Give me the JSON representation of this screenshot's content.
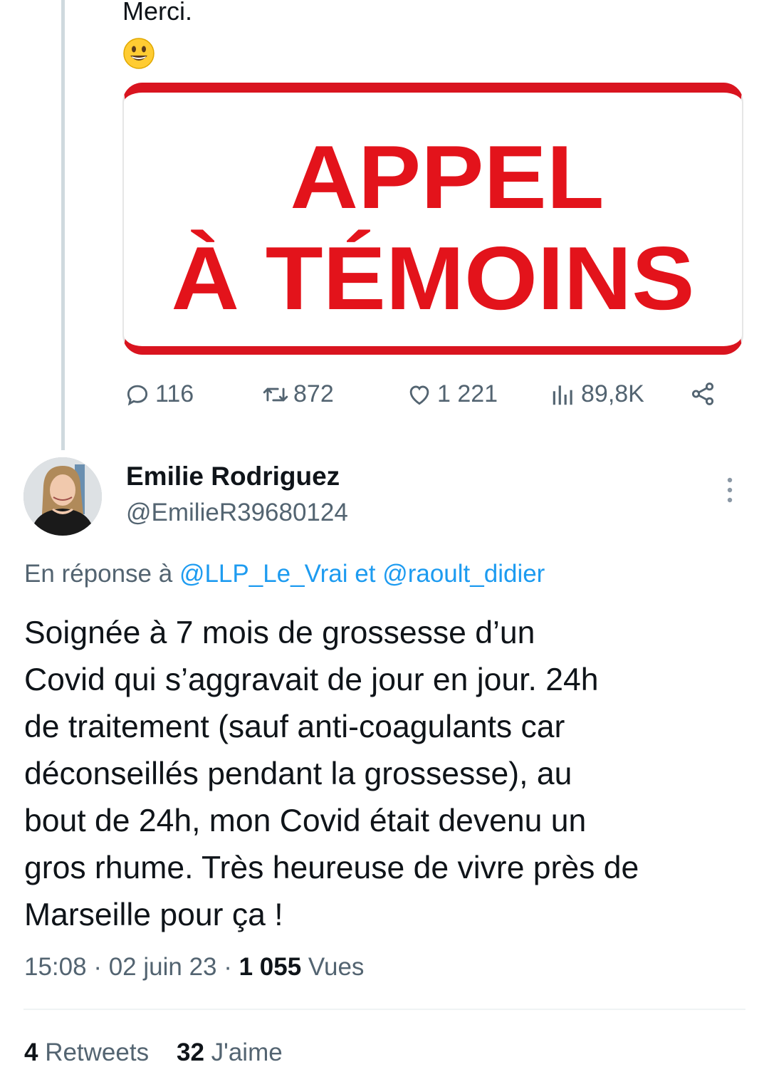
{
  "parent_tweet": {
    "text": "Merci.",
    "media": {
      "line1": "APPEL",
      "line2": "À TÉMOINS"
    },
    "actions": {
      "replies": "116",
      "retweets": "872",
      "likes": "1 221",
      "views": "89,8K"
    }
  },
  "tweet": {
    "author_name": "Emilie Rodriguez",
    "author_handle": "@EmilieR39680124",
    "reply_prefix": "En réponse à ",
    "reply_user1": "@LLP_Le_Vrai",
    "reply_and": " et ",
    "reply_user2": "@raoult_didier",
    "body": "Soignée à 7 mois de grossesse d’un\nCovid qui s’aggravait de jour en jour. 24h\nde traitement (sauf anti-coagulants car\ndéconseillés pendant la grossesse), au\nbout de 24h, mon Covid était devenu un\ngros rhume. Très heureuse de vivre près de\nMarseille pour ça !",
    "time": "15:08",
    "date": "02 juin 23",
    "separator": " · ",
    "views_count": "1 055",
    "views_label": " Vues",
    "retweets_count": "4",
    "retweets_label": " Retweets",
    "likes_count": "32",
    "likes_label": " J'aime"
  },
  "colors": {
    "accent": "#1d9bf0",
    "secondary_text": "#536471",
    "media_red": "#e3131b"
  }
}
